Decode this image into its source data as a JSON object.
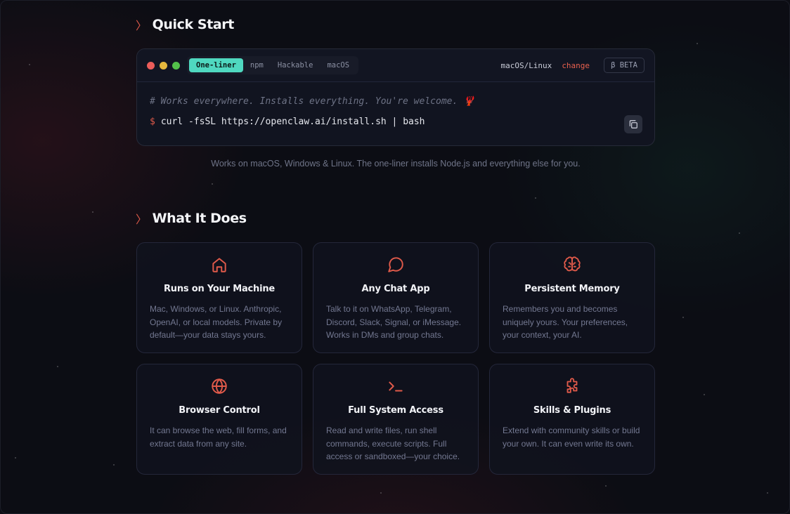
{
  "quick_start": {
    "title": "Quick Start",
    "tabs": [
      "One-liner",
      "npm",
      "Hackable",
      "macOS"
    ],
    "os_label": "macOS/Linux",
    "change_label": "change",
    "beta_label": "β BETA",
    "comment": "# Works everywhere. Installs everything. You're welcome. 🦞",
    "prompt": "$",
    "command": "curl -fsSL https://openclaw.ai/install.sh | bash",
    "note": "Works on macOS, Windows & Linux. The one-liner installs Node.js and everything else for you."
  },
  "what_it_does": {
    "title": "What It Does",
    "cards": [
      {
        "icon": "home-icon",
        "title": "Runs on Your Machine",
        "text": "Mac, Windows, or Linux. Anthropic, OpenAI, or local models. Private by default—your data stays yours."
      },
      {
        "icon": "chat-bubble-icon",
        "title": "Any Chat App",
        "text": "Talk to it on WhatsApp, Telegram, Discord, Slack, Signal, or iMessage. Works in DMs and group chats."
      },
      {
        "icon": "brain-icon",
        "title": "Persistent Memory",
        "text": "Remembers you and becomes uniquely yours. Your preferences, your context, your AI."
      },
      {
        "icon": "globe-icon",
        "title": "Browser Control",
        "text": "It can browse the web, fill forms, and extract data from any site."
      },
      {
        "icon": "terminal-icon",
        "title": "Full System Access",
        "text": "Read and write files, run shell commands, execute scripts. Full access or sandboxed—your choice."
      },
      {
        "icon": "puzzle-icon",
        "title": "Skills & Plugins",
        "text": "Extend with community skills or build your own. It can even write its own."
      }
    ]
  },
  "colors": {
    "accent": "#e05a4a",
    "active_tab": "#4fd8c0",
    "dot_red": "#ec5d5a",
    "dot_yellow": "#e5b73e",
    "dot_green": "#53c14a"
  }
}
